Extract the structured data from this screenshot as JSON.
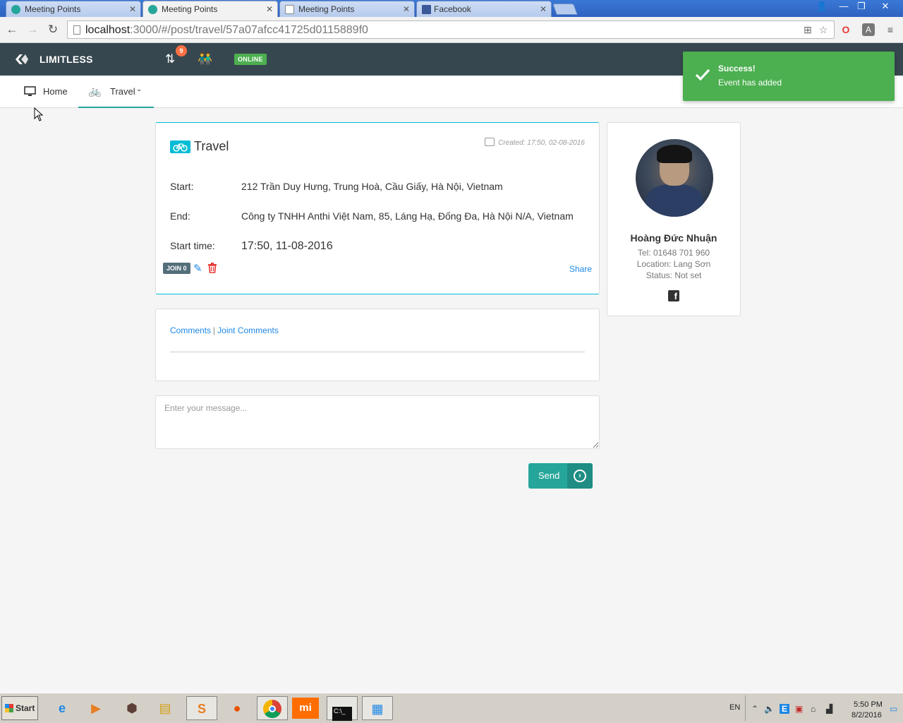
{
  "browser": {
    "tabs": [
      {
        "label": "Meeting Points",
        "active": false
      },
      {
        "label": "Meeting Points",
        "active": true
      },
      {
        "label": "Meeting Points",
        "active": false
      },
      {
        "label": "Facebook",
        "active": false
      }
    ],
    "url_host": "localhost",
    "url_rest": ":3000/#/post/travel/57a07afcc41725d0115889f0"
  },
  "app": {
    "brand": "LIMITLESS",
    "notification_count": "9",
    "status_label": "ONLINE"
  },
  "subnav": {
    "home": "Home",
    "travel": "Travel"
  },
  "post": {
    "category": "Travel",
    "created": "Created: 17:50, 02-08-2016",
    "start_label": "Start:",
    "start_value": "212 Trần Duy Hưng, Trung Hoà, Cầu Giấy, Hà Nội, Vietnam",
    "end_label": "End:",
    "end_value": "Công ty TNHH Anthi Việt Nam, 85, Láng Hạ, Đống Đa, Hà Nội N/A, Vietnam",
    "time_label": "Start time:",
    "time_value": "17:50, 11-08-2016",
    "join_label": "JOIN 0",
    "share_label": "Share"
  },
  "comments": {
    "tab_comments": "Comments",
    "separator": "|",
    "tab_joint": "Joint Comments",
    "placeholder": "Enter your message...",
    "send_label": "Send"
  },
  "profile": {
    "name": "Hoàng Đức Nhuận",
    "tel": "Tel: 01648 701 960",
    "location": "Location: Lang Sơn",
    "status": "Status: Not set",
    "fb_glyph": "f"
  },
  "toast": {
    "title": "Success!",
    "message": "Event has added"
  },
  "taskbar": {
    "start": "Start",
    "lang": "EN",
    "time": "5:50 PM",
    "date": "8/2/2016"
  },
  "colors": {
    "appbar": "#37474f",
    "accent_teal": "#26a69a",
    "travel_cyan": "#00bcd4",
    "success_green": "#4caf50",
    "link_blue": "#1e88e5"
  }
}
